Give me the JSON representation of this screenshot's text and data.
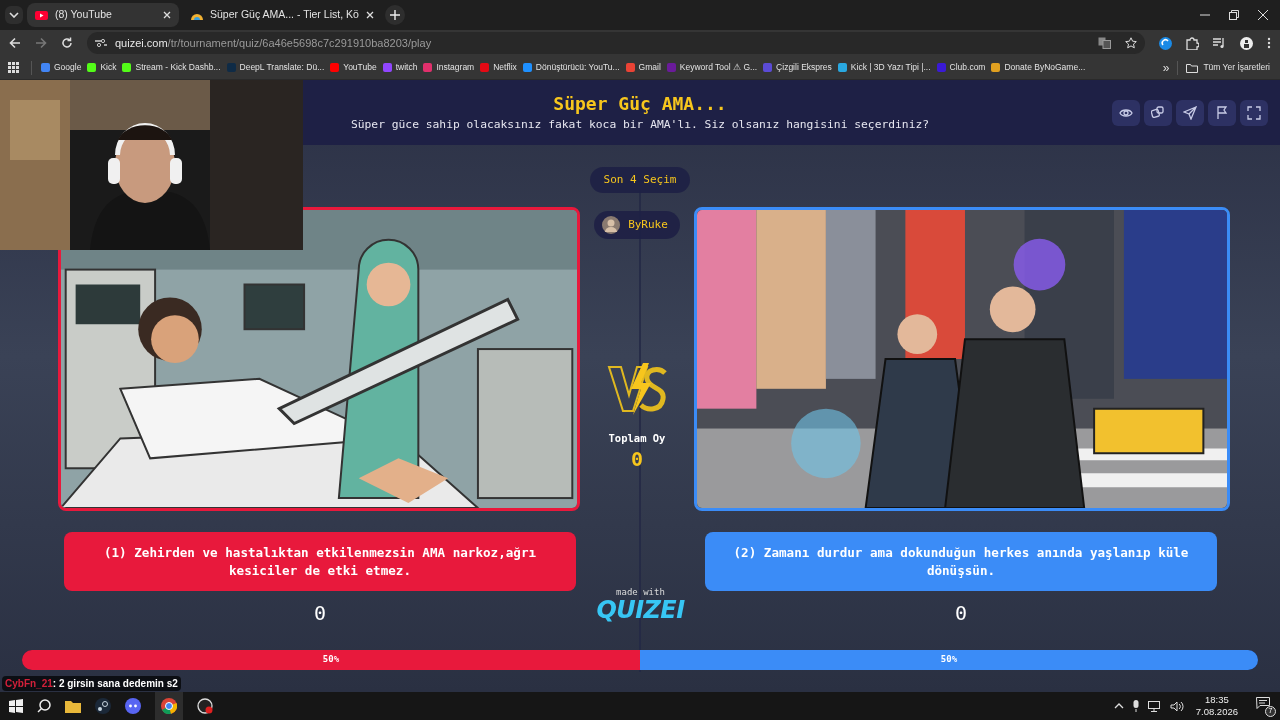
{
  "browser": {
    "tabs": [
      {
        "title": "(8) YouTube",
        "selected": true
      },
      {
        "title": "Süper Güç AMA... - Tier List, Kö",
        "selected": false
      }
    ],
    "url_host": "quizei.com",
    "url_path": "/tr/tournament/quiz/6a46e5698c7c291910ba8203/play",
    "bookmarks": [
      {
        "label": "Google",
        "color": "#4285f4"
      },
      {
        "label": "Kick",
        "color": "#53fc18"
      },
      {
        "label": "Stream - Kick Dashb...",
        "color": "#53fc18"
      },
      {
        "label": "DeepL Translate: Dü...",
        "color": "#0f2b46"
      },
      {
        "label": "YouTube",
        "color": "#ff0000"
      },
      {
        "label": "twitch",
        "color": "#9146ff"
      },
      {
        "label": "Instagram",
        "color": "#e1306c"
      },
      {
        "label": "Netflix",
        "color": "#e50914"
      },
      {
        "label": "Dönüştürücü: YouTu...",
        "color": "#1e90ff"
      },
      {
        "label": "Gmail",
        "color": "#ea4335"
      },
      {
        "label": "Keyword Tool ⚠ G...",
        "color": "#6a1b9a"
      },
      {
        "label": "Çizgili Ekspres",
        "color": "#5b4bd6"
      },
      {
        "label": "Kick | 3D Yazı Tipi |...",
        "color": "#29a8e0"
      },
      {
        "label": "Club.com",
        "color": "#3a1ad6"
      },
      {
        "label": "Donate ByNoGame...",
        "color": "#e0a020"
      }
    ],
    "more": "»",
    "all_bookmarks": "Tüm Yer İşaretleri"
  },
  "quiz": {
    "title": "Süper Güç AMA...",
    "subtitle": "Süper güce sahip olacaksınız fakat koca bir AMA'lı. Siz olsanız hangisini seçerdiniz?",
    "recent_label": "Son 4 Seçim",
    "creator": "ByRuke",
    "total_label": "Toplam Oy",
    "total": "0",
    "made_with": "made with",
    "logo": "QUIZEI",
    "options": [
      {
        "text": "(1) Zehirden ve hastalıktan etkilenmezsin AMA narkoz,ağrı kesiciler de etki etmez.",
        "votes": "0",
        "percent": "50%",
        "level": 0.5,
        "color": "#e8193c"
      },
      {
        "text": "(2) Zamanı durdur ama dokunduğun herkes anında yaşlanıp küle dönüşsün.",
        "votes": "0",
        "percent": "50%",
        "level": 0.5,
        "color": "#3b8cf7"
      }
    ]
  },
  "stream_chat": {
    "user": "CybFn_21",
    "message": ": 2 girsin sana dedemin s2"
  },
  "taskbar": {
    "time": "18:35",
    "date": "7.08.2026",
    "notifications": "7"
  }
}
